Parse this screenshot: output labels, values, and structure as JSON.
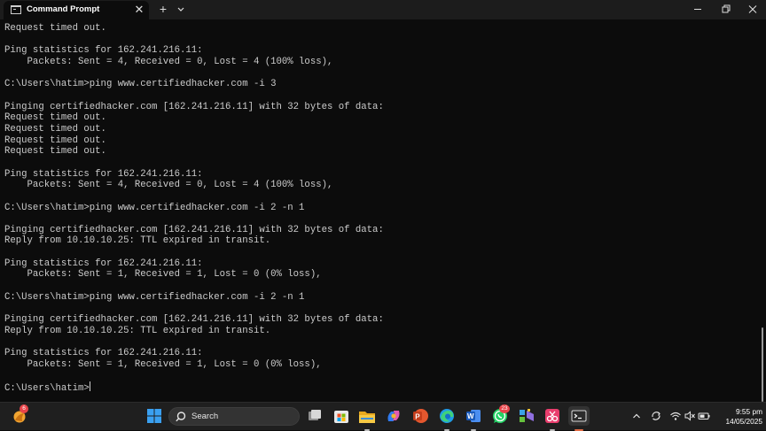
{
  "window": {
    "tab_title": "Command Prompt",
    "tab_close_glyph": "✕",
    "new_tab_glyph": "+",
    "icons": {
      "tab": "console-icon",
      "close": "close-icon",
      "new_tab": "plus-icon",
      "dropdown": "chevron-down-icon",
      "minimize": "minimize-icon",
      "maximize": "restore-icon",
      "window_close": "close-icon"
    }
  },
  "terminal": {
    "text_color": "#cccccc",
    "background": "#0c0c0c",
    "lines": [
      "Request timed out.",
      "",
      "Ping statistics for 162.241.216.11:",
      "    Packets: Sent = 4, Received = 0, Lost = 4 (100% loss),",
      "",
      "C:\\Users\\hatim>ping www.certifiedhacker.com -i 3",
      "",
      "Pinging certifiedhacker.com [162.241.216.11] with 32 bytes of data:",
      "Request timed out.",
      "Request timed out.",
      "Request timed out.",
      "Request timed out.",
      "",
      "Ping statistics for 162.241.216.11:",
      "    Packets: Sent = 4, Received = 0, Lost = 4 (100% loss),",
      "",
      "C:\\Users\\hatim>ping www.certifiedhacker.com -i 2 -n 1",
      "",
      "Pinging certifiedhacker.com [162.241.216.11] with 32 bytes of data:",
      "Reply from 10.10.10.25: TTL expired in transit.",
      "",
      "Ping statistics for 162.241.216.11:",
      "    Packets: Sent = 1, Received = 1, Lost = 0 (0% loss),",
      "",
      "C:\\Users\\hatim>ping www.certifiedhacker.com -i 2 -n 1",
      "",
      "Pinging certifiedhacker.com [162.241.216.11] with 32 bytes of data:",
      "Reply from 10.10.10.25: TTL expired in transit.",
      "",
      "Ping statistics for 162.241.216.11:",
      "    Packets: Sent = 1, Received = 1, Lost = 0 (0% loss),",
      ""
    ],
    "prompt": "C:\\Users\\hatim>"
  },
  "taskbar": {
    "search_placeholder": "Search",
    "weather_badge": "6",
    "whatsapp_badge": "23",
    "clock_time": "9:55 pm",
    "clock_date": "14/05/2025",
    "apps": [
      "weather-icon",
      "windows-start-icon",
      "search-icon",
      "task-view-icon",
      "microsoft-store-icon",
      "file-explorer-icon",
      "copilot-icon",
      "powerpoint-icon",
      "edge-icon",
      "word-icon",
      "whatsapp-icon",
      "visual-studio-icon",
      "snipping-tool-icon",
      "terminal-icon"
    ],
    "tray": [
      "chevron-up-icon",
      "sync-icon",
      "wifi-icon",
      "volume-muted-icon",
      "battery-icon"
    ],
    "accent": "#e06a43"
  }
}
